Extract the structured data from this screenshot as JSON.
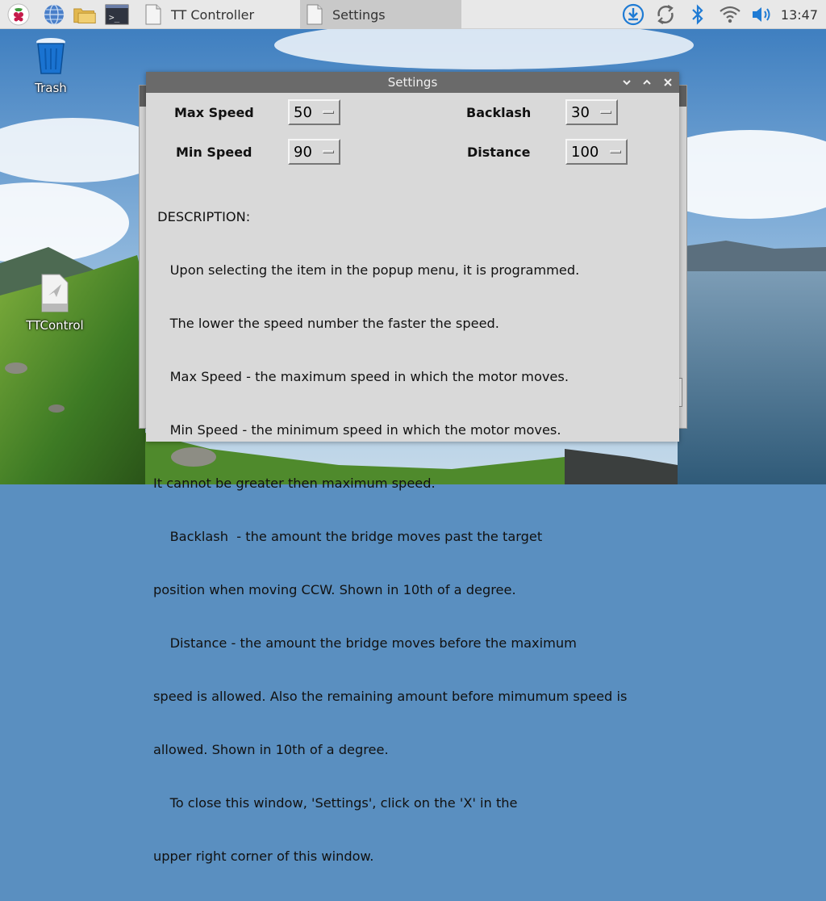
{
  "taskbar": {
    "tasks": [
      {
        "label": "TT Controller"
      },
      {
        "label": "Settings"
      }
    ],
    "clock": "13:47"
  },
  "desktop": {
    "icons": [
      {
        "label": "Trash"
      },
      {
        "label": "TTControl"
      }
    ]
  },
  "window": {
    "title": "Settings",
    "controls": {
      "max_speed": {
        "label": "Max Speed",
        "value": "50"
      },
      "min_speed": {
        "label": "Min Speed",
        "value": "90"
      },
      "backlash": {
        "label": "Backlash",
        "value": "30"
      },
      "distance": {
        "label": "Distance",
        "value": "100"
      }
    },
    "description": [
      " DESCRIPTION:",
      "    Upon selecting the item in the popup menu, it is programmed.",
      "    The lower the speed number the faster the speed.",
      "    Max Speed - the maximum speed in which the motor moves.",
      "    Min Speed - the minimum speed in which the motor moves.",
      "It cannot be greater then maximum speed.",
      "    Backlash  - the amount the bridge moves past the target",
      "position when moving CCW. Shown in 10th of a degree.",
      "    Distance - the amount the bridge moves before the maximum",
      "speed is allowed. Also the remaining amount before mimumum speed is",
      "allowed. Shown in 10th of a degree.",
      "    To close this window, 'Settings', click on the 'X' in the",
      "upper right corner of this window."
    ]
  },
  "colors": {
    "taskbar_bg": "#e8e8e8",
    "titlebar_bg": "#6a6a6a",
    "window_bg": "#d9d9d9",
    "tray_accent": "#1f7bd4"
  }
}
